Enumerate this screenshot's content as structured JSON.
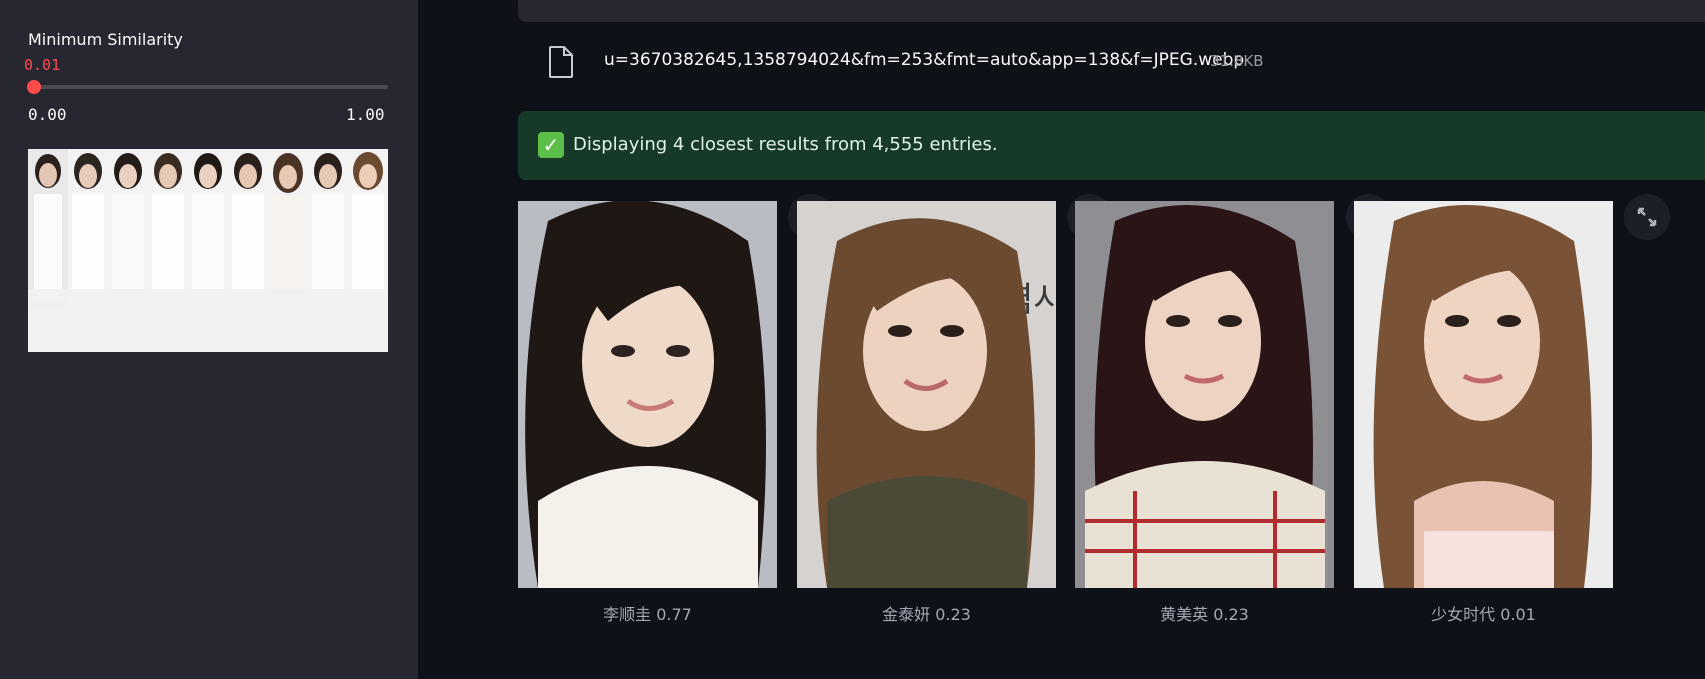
{
  "sidebar": {
    "slider": {
      "label": "Minimum Similarity",
      "value": "0.01",
      "min_label": "0.00",
      "max_label": "1.00",
      "fraction": 0.01,
      "accent_color": "#ff4b4b"
    },
    "preview_image": "group-photo"
  },
  "upload": {
    "icon": "file-icon",
    "file_name": "u=3670382645,1358794024&fm=253&fmt=auto&app=138&f=JPEG.webp",
    "file_size": "31.8KB"
  },
  "status": {
    "icon": "check-icon",
    "message": "Displaying 4 closest results from 4,555 entries."
  },
  "results": [
    {
      "caption": "李顺圭 0.77"
    },
    {
      "caption": "金泰妍 0.23"
    },
    {
      "caption": "黄美英 0.23"
    },
    {
      "caption": "少女时代 0.01"
    }
  ],
  "colors": {
    "background": "#0e1117",
    "sidebar": "#262730",
    "success_bg": "#173928"
  }
}
